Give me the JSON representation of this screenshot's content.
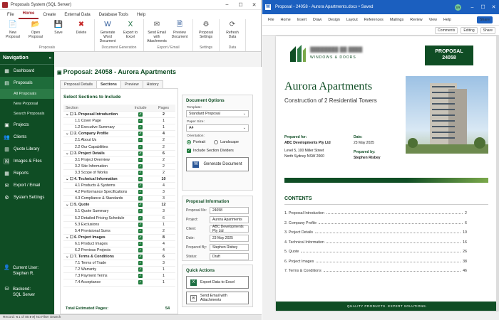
{
  "left_app": {
    "title": "Proposals System (SQL Server)",
    "menu": [
      "File",
      "Home",
      "Create",
      "External Data",
      "Database Tools",
      "Help"
    ],
    "active_menu": "Home",
    "ribbon": [
      {
        "group": "Proposals",
        "buttons": [
          {
            "label": "New Proposal",
            "icon": "new-document-icon"
          },
          {
            "label": "Open Proposal",
            "icon": "open-folder-icon"
          },
          {
            "label": "Save",
            "icon": "save-icon"
          },
          {
            "label": "Delete",
            "icon": "delete-icon"
          }
        ]
      },
      {
        "group": "Document Generation",
        "buttons": [
          {
            "label": "Generate Word Document",
            "icon": "word-icon"
          },
          {
            "label": "Export to Excel",
            "icon": "excel-icon"
          }
        ]
      },
      {
        "group": "Export / Email",
        "buttons": [
          {
            "label": "Send Email with Attachments",
            "icon": "email-icon"
          },
          {
            "label": "Preview Document",
            "icon": "preview-icon"
          }
        ]
      },
      {
        "group": "Settings",
        "buttons": [
          {
            "label": "Proposal Settings",
            "icon": "gear-icon"
          }
        ]
      },
      {
        "group": "Data",
        "buttons": [
          {
            "label": "Refresh Data",
            "icon": "refresh-icon"
          }
        ]
      }
    ],
    "nav": {
      "header": "Navigation",
      "items": [
        "Dashboard",
        "Proposals",
        "All Proposals",
        "New Proposal",
        "Search Proposals",
        "Projects",
        "Clients",
        "Quote Library",
        "Images & Files",
        "Reports",
        "Export / Email",
        "System Settings"
      ],
      "user_label": "Current User:",
      "user_name": "Stephen R.",
      "backend_label": "Backend:",
      "backend_value": "SQL Server"
    },
    "page_title": "Proposal: 24058 - Aurora Apartments",
    "tabs": [
      "Proposal Details",
      "Sections",
      "Preview",
      "History"
    ],
    "active_tab": "Sections",
    "sections_title": "Select Sections to Include",
    "table_headers": [
      "Section",
      "Include",
      "Pages"
    ],
    "sections": [
      {
        "name": "1. Proposal Introduction",
        "pages": "2",
        "group": true
      },
      {
        "name": "1.1 Cover Page",
        "pages": "1",
        "group": false
      },
      {
        "name": "1.2 Executive Summary",
        "pages": "1",
        "group": false
      },
      {
        "name": "2. Company Profile",
        "pages": "4",
        "group": true
      },
      {
        "name": "2.1 About Us",
        "pages": "2",
        "group": false
      },
      {
        "name": "2.2 Our Capabilities",
        "pages": "2",
        "group": false
      },
      {
        "name": "3. Project Details",
        "pages": "6",
        "group": true
      },
      {
        "name": "3.1 Project Overview",
        "pages": "2",
        "group": false
      },
      {
        "name": "3.2 Site Information",
        "pages": "2",
        "group": false
      },
      {
        "name": "3.3 Scope of Works",
        "pages": "2",
        "group": false
      },
      {
        "name": "4. Technical Information",
        "pages": "10",
        "group": true
      },
      {
        "name": "4.1 Products & Systems",
        "pages": "4",
        "group": false
      },
      {
        "name": "4.2 Performance Specifications",
        "pages": "3",
        "group": false
      },
      {
        "name": "4.3 Compliance & Standards",
        "pages": "3",
        "group": false
      },
      {
        "name": "5. Quote",
        "pages": "12",
        "group": true
      },
      {
        "name": "5.1 Quote Summary",
        "pages": "3",
        "group": false
      },
      {
        "name": "5.2 Detailed Pricing Schedule",
        "pages": "6",
        "group": false
      },
      {
        "name": "5.3 Exclusions",
        "pages": "1",
        "group": false
      },
      {
        "name": "5.4 Provisional Sums",
        "pages": "2",
        "group": false
      },
      {
        "name": "6. Project Images",
        "pages": "8",
        "group": true
      },
      {
        "name": "6.1 Product Images",
        "pages": "4",
        "group": false
      },
      {
        "name": "6.2 Previous Projects",
        "pages": "4",
        "group": false
      },
      {
        "name": "7. Terms & Conditions",
        "pages": "6",
        "group": true
      },
      {
        "name": "7.1 Terms of Trade",
        "pages": "3",
        "group": false
      },
      {
        "name": "7.2 Warranty",
        "pages": "1",
        "group": false
      },
      {
        "name": "7.3 Payment Terms",
        "pages": "1",
        "group": false
      },
      {
        "name": "7.4 Acceptance",
        "pages": "1",
        "group": false
      }
    ],
    "total_label": "Total Estimated Pages:",
    "total_value": "54",
    "doc_options": {
      "title": "Document Options",
      "template_label": "Template:",
      "template_value": "Standard Proposal",
      "paper_label": "Paper Size:",
      "paper_value": "A4",
      "orientation_label": "Orientation:",
      "portrait": "Portrait",
      "landscape": "Landscape",
      "dividers": "Include Section Dividers",
      "generate": "Generate Document"
    },
    "proposal_info": {
      "title": "Proposal Information",
      "rows": [
        {
          "k": "Proposal No:",
          "v": "24058"
        },
        {
          "k": "Project:",
          "v": "Aurora Apartments"
        },
        {
          "k": "Client:",
          "v": "ABC Developments Pty Ltd"
        },
        {
          "k": "Date:",
          "v": "23 May 2025"
        },
        {
          "k": "Prepared By:",
          "v": "Stephen Risbey"
        },
        {
          "k": "Status:",
          "v": "Draft"
        }
      ]
    },
    "quick_actions": {
      "title": "Quick Actions",
      "excel": "Export Data to Excel",
      "email": "Send Email with Attachments"
    },
    "status": "Record:  ◂ 1 of 85 ▸  ▸|   No Filter   Search"
  },
  "word": {
    "title": "Proposal - 24058 - Aurora Apartments.docx • Saved",
    "avatar": "SR",
    "menu": [
      "File",
      "Home",
      "Insert",
      "Draw",
      "Design",
      "Layout",
      "References",
      "Mailings",
      "Review",
      "View",
      "Help"
    ],
    "share": "Share",
    "comments": "Comments",
    "editing": "Editing",
    "share2": "Share",
    "doc": {
      "company_sub": "WINDOWS & DOORS",
      "proposal_label": "PROPOSAL",
      "proposal_no": "24058",
      "title": "Aurora Apartments",
      "subtitle": "Construction of 2 Residential Towers",
      "prepared_for_label": "Prepared for:",
      "client": "ABC Developments Pty Ltd",
      "addr1": "Level 5, 100 Miller Street",
      "addr2": "North Sydney NSW 2060",
      "date_label": "Date:",
      "date": "23 May 2025",
      "prepared_by_label": "Prepared by:",
      "prepared_by": "Stephen Risbey",
      "contents_title": "CONTENTS",
      "toc": [
        {
          "t": "1.   Proposal Introduction",
          "p": "2"
        },
        {
          "t": "2.   Company Profile",
          "p": "6"
        },
        {
          "t": "3.   Project Details",
          "p": "10"
        },
        {
          "t": "4.   Technical Information",
          "p": "16"
        },
        {
          "t": "5.   Quote",
          "p": "26"
        },
        {
          "t": "6.   Project Images",
          "p": "38"
        },
        {
          "t": "7.   Terms & Conditions",
          "p": "46"
        }
      ],
      "footer": "QUALITY PRODUCTS. EXPERT SOLUTIONS."
    }
  },
  "colors": {
    "brand_green": "#0f4d24",
    "access_red": "#a4262c",
    "word_blue": "#1b5fbf"
  }
}
